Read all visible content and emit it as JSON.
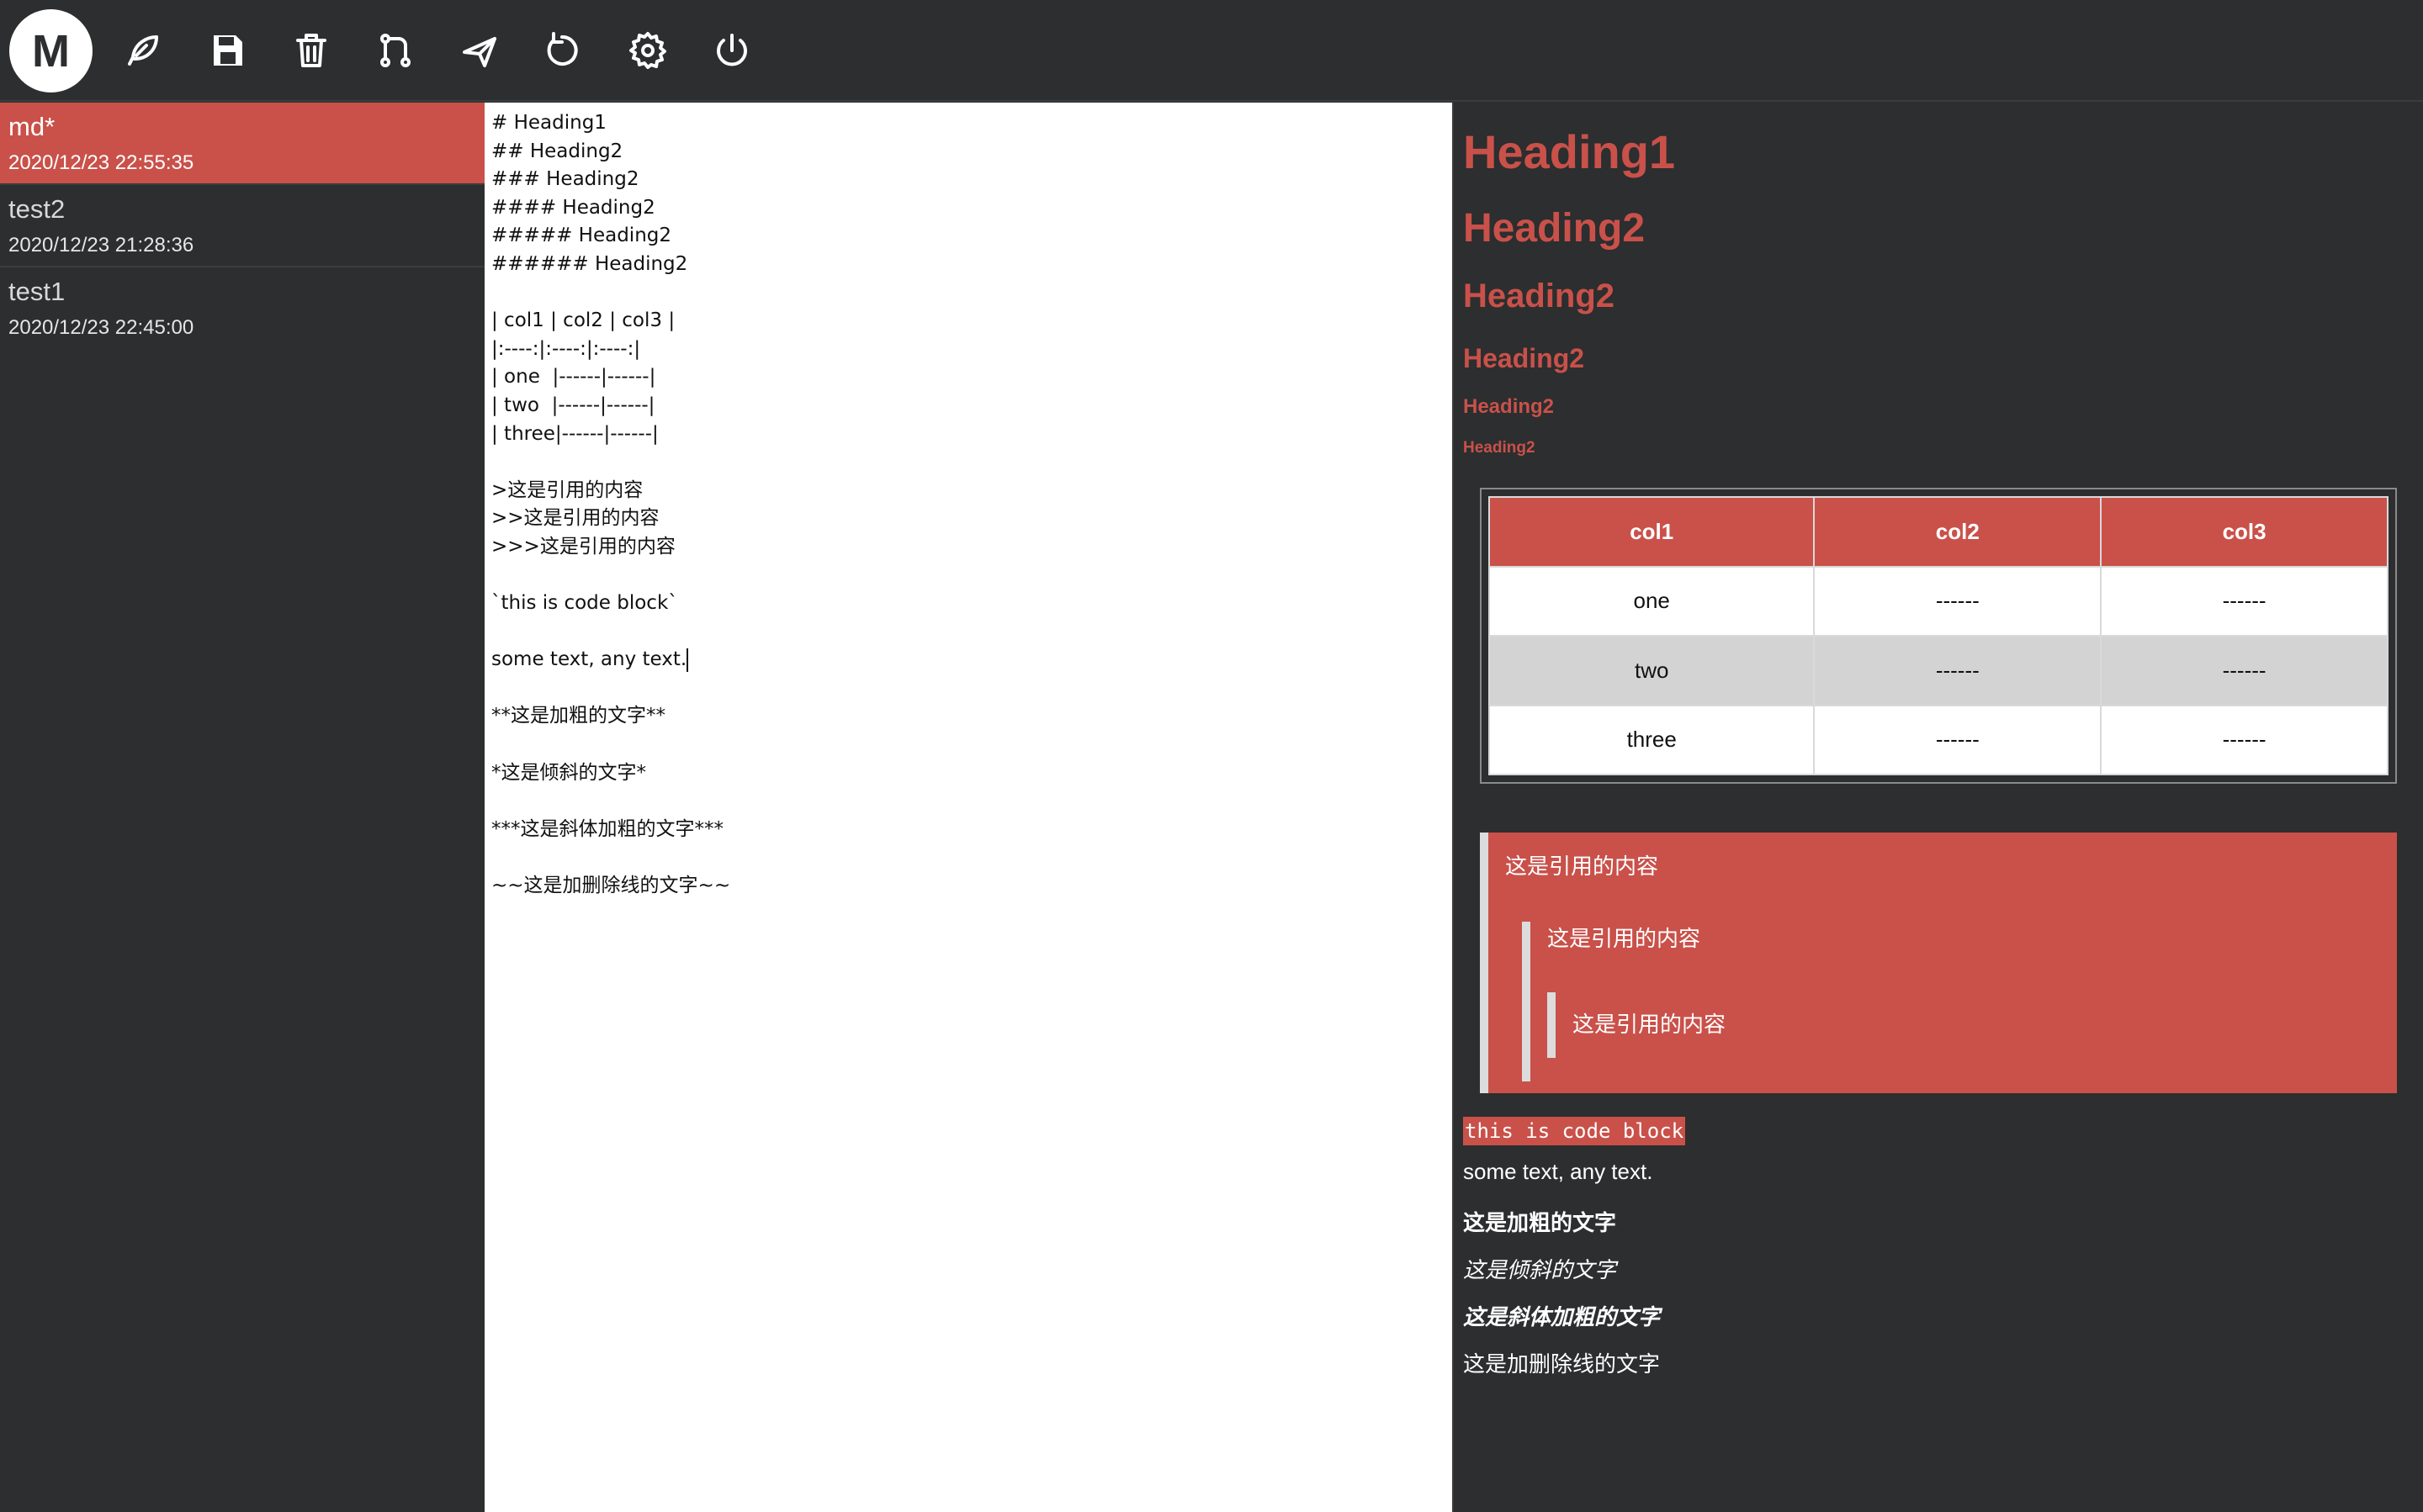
{
  "app": {
    "logo_text": "M",
    "accent_color": "#c9514a",
    "background_color": "#2c2e2f"
  },
  "toolbar": {
    "icons": [
      "new-note-icon",
      "save-icon",
      "delete-icon",
      "git-branch-icon",
      "send-icon",
      "refresh-icon",
      "settings-icon",
      "power-icon"
    ]
  },
  "sidebar": {
    "files": [
      {
        "name": "md*",
        "date": "2020/12/23 22:55:35",
        "active": true
      },
      {
        "name": "test2",
        "date": "2020/12/23 21:28:36",
        "active": false
      },
      {
        "name": "test1",
        "date": "2020/12/23 22:45:00",
        "active": false
      }
    ]
  },
  "editor": {
    "lines": [
      "# Heading1",
      "## Heading2",
      "### Heading2",
      "#### Heading2",
      "##### Heading2",
      "###### Heading2",
      "",
      "| col1 | col2 | col3 |",
      "|:----:|:----:|:----:|",
      "| one  |------|------|",
      "| two  |------|------|",
      "| three|------|------|",
      "",
      ">这是引用的内容",
      ">>这是引用的内容",
      ">>>这是引用的内容",
      "",
      "`this is code block`",
      "",
      "some text, any text.",
      "",
      "**这是加粗的文字**",
      "",
      "*这是倾斜的文字*",
      "",
      "***这是斜体加粗的文字***",
      "",
      "~~这是加删除线的文字~~"
    ]
  },
  "preview": {
    "headings": [
      "Heading1",
      "Heading2",
      "Heading2",
      "Heading2",
      "Heading2",
      "Heading2"
    ],
    "table": {
      "headers": [
        "col1",
        "col2",
        "col3"
      ],
      "rows": [
        [
          "one",
          "------",
          "------"
        ],
        [
          "two",
          "------",
          "------"
        ],
        [
          "three",
          "------",
          "------"
        ]
      ]
    },
    "quotes": [
      "这是引用的内容",
      "这是引用的内容",
      "这是引用的内容"
    ],
    "code": "this is code block",
    "text": "some text, any text.",
    "bold": "这是加粗的文字",
    "italic": "这是倾斜的文字",
    "bold_italic": "这是斜体加粗的文字",
    "strike": "这是加删除线的文字"
  }
}
